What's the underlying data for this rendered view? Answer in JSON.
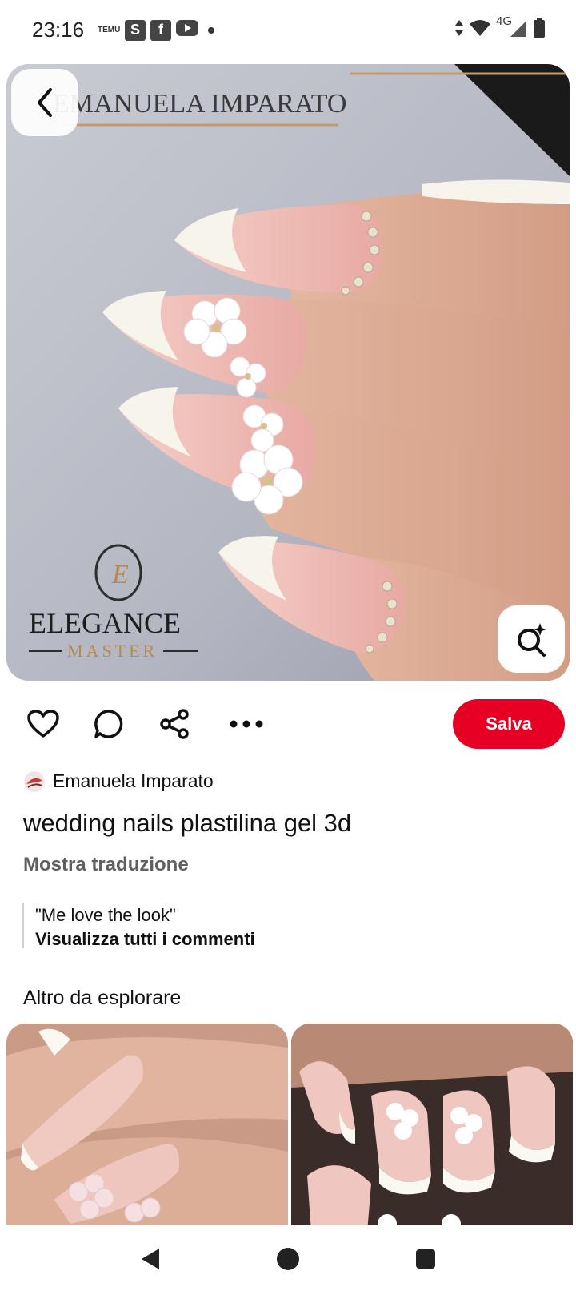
{
  "status_bar": {
    "time": "23:16",
    "left_icons": [
      "temu-icon",
      "s-icon",
      "facebook-icon",
      "youtube-icon",
      "dot-icon"
    ],
    "temu_label": "TEMU",
    "s_label": "S",
    "facebook_label": "f",
    "network_label": "4G",
    "right_icons": [
      "data-arrows-icon",
      "wifi-icon",
      "signal-icon",
      "battery-icon"
    ]
  },
  "pin": {
    "image_watermark_top": "EMANUELA IMPARATO",
    "image_logo_name": "ELEGANCE",
    "image_logo_sub": "MASTER",
    "image_logo_letter": "E",
    "author": "Emanuela Imparato",
    "title": "wedding nails plastilina gel 3d",
    "translate_link": "Mostra traduzione",
    "comment": "\"Me love the look\"",
    "all_comments": "Visualizza tutti i commenti"
  },
  "actions": {
    "save_label": "Salva",
    "icons": [
      "heart-icon",
      "comment-icon",
      "share-icon",
      "more-icon"
    ]
  },
  "explore": {
    "title": "Altro da esplorare"
  },
  "colors": {
    "accent": "#e60023",
    "text": "#111111",
    "secondary_text": "#5f5f5f"
  }
}
